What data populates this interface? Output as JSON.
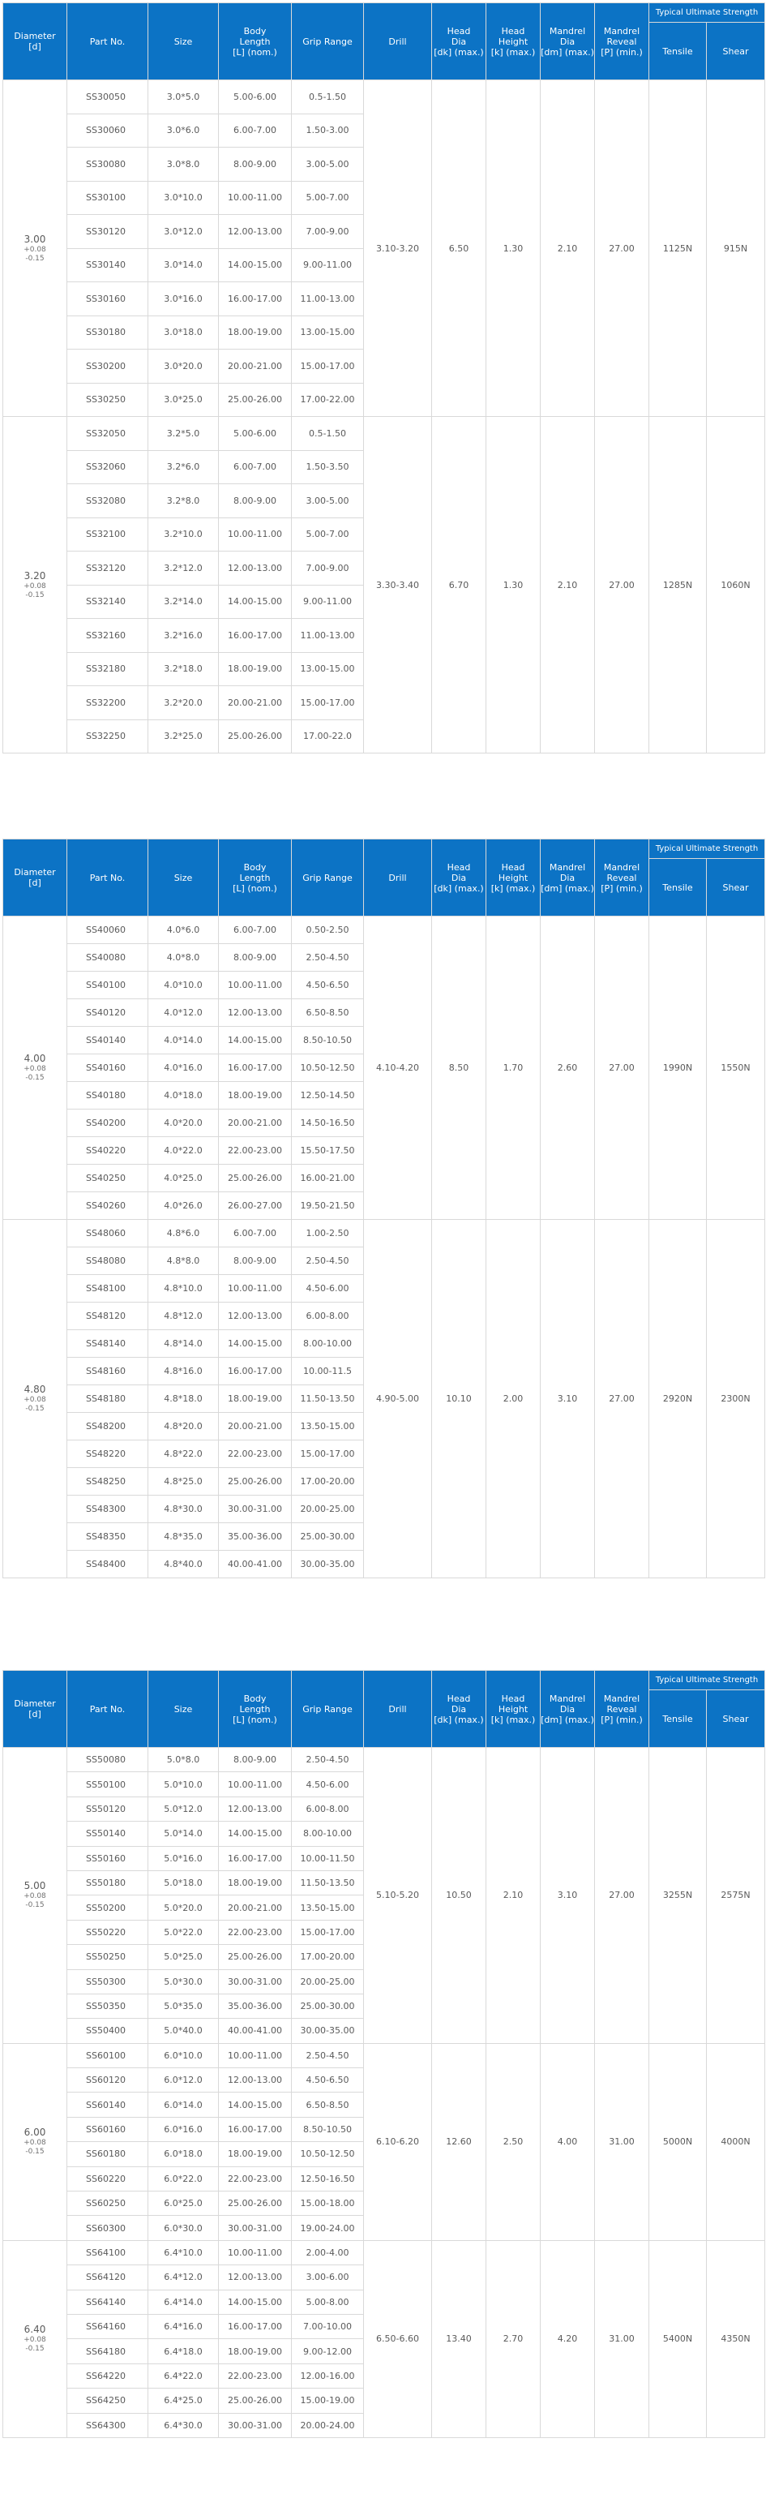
{
  "headers": {
    "diameter": [
      "Diameter",
      "[d]"
    ],
    "part_no": "Part No.",
    "size": "Size",
    "body_length": [
      "Body",
      "Length",
      "[L] (nom.)"
    ],
    "grip_range": "Grip Range",
    "drill": "Drill",
    "head_dia": [
      "Head",
      "Dia",
      "[dk] (max.)"
    ],
    "head_height": [
      "Head",
      "Height",
      "[k] (max.)"
    ],
    "mandrel_dia": [
      "Mandrel",
      "Dia",
      "[dm] (max.)"
    ],
    "mandrel_reveal": [
      "Mandrel",
      "Reveal",
      "[P] (min.)"
    ],
    "typical_strength": "Typical Ultimate Strength",
    "tensile": "Tensile",
    "shear": "Shear"
  },
  "tables": [
    {
      "groups": [
        {
          "diameter": "3.00",
          "tol_plus": "+0.08",
          "tol_minus": "-0.15",
          "drill": "3.10-3.20",
          "head_dia": "6.50",
          "head_height": "1.30",
          "mandrel_dia": "2.10",
          "mandrel_reveal": "27.00",
          "tensile": "1125N",
          "shear": "915N",
          "rows": [
            [
              "SS30050",
              "3.0*5.0",
              "5.00-6.00",
              "0.5-1.50"
            ],
            [
              "SS30060",
              "3.0*6.0",
              "6.00-7.00",
              "1.50-3.00"
            ],
            [
              "SS30080",
              "3.0*8.0",
              "8.00-9.00",
              "3.00-5.00"
            ],
            [
              "SS30100",
              "3.0*10.0",
              "10.00-11.00",
              "5.00-7.00"
            ],
            [
              "SS30120",
              "3.0*12.0",
              "12.00-13.00",
              "7.00-9.00"
            ],
            [
              "SS30140",
              "3.0*14.0",
              "14.00-15.00",
              "9.00-11.00"
            ],
            [
              "SS30160",
              "3.0*16.0",
              "16.00-17.00",
              "11.00-13.00"
            ],
            [
              "SS30180",
              "3.0*18.0",
              "18.00-19.00",
              "13.00-15.00"
            ],
            [
              "SS30200",
              "3.0*20.0",
              "20.00-21.00",
              "15.00-17.00"
            ],
            [
              "SS30250",
              "3.0*25.0",
              "25.00-26.00",
              "17.00-22.00"
            ]
          ]
        },
        {
          "diameter": "3.20",
          "tol_plus": "+0.08",
          "tol_minus": "-0.15",
          "drill": "3.30-3.40",
          "head_dia": "6.70",
          "head_height": "1.30",
          "mandrel_dia": "2.10",
          "mandrel_reveal": "27.00",
          "tensile": "1285N",
          "shear": "1060N",
          "rows": [
            [
              "SS32050",
              "3.2*5.0",
              "5.00-6.00",
              "0.5-1.50"
            ],
            [
              "SS32060",
              "3.2*6.0",
              "6.00-7.00",
              "1.50-3.50"
            ],
            [
              "SS32080",
              "3.2*8.0",
              "8.00-9.00",
              "3.00-5.00"
            ],
            [
              "SS32100",
              "3.2*10.0",
              "10.00-11.00",
              "5.00-7.00"
            ],
            [
              "SS32120",
              "3.2*12.0",
              "12.00-13.00",
              "7.00-9.00"
            ],
            [
              "SS32140",
              "3.2*14.0",
              "14.00-15.00",
              "9.00-11.00"
            ],
            [
              "SS32160",
              "3.2*16.0",
              "16.00-17.00",
              "11.00-13.00"
            ],
            [
              "SS32180",
              "3.2*18.0",
              "18.00-19.00",
              "13.00-15.00"
            ],
            [
              "SS32200",
              "3.2*20.0",
              "20.00-21.00",
              "15.00-17.00"
            ],
            [
              "SS32250",
              "3.2*25.0",
              "25.00-26.00",
              "17.00-22.0"
            ]
          ]
        }
      ]
    },
    {
      "groups": [
        {
          "diameter": "4.00",
          "tol_plus": "+0.08",
          "tol_minus": "-0.15",
          "drill": "4.10-4.20",
          "head_dia": "8.50",
          "head_height": "1.70",
          "mandrel_dia": "2.60",
          "mandrel_reveal": "27.00",
          "tensile": "1990N",
          "shear": "1550N",
          "rows": [
            [
              "SS40060",
              "4.0*6.0",
              "6.00-7.00",
              "0.50-2.50"
            ],
            [
              "SS40080",
              "4.0*8.0",
              "8.00-9.00",
              "2.50-4.50"
            ],
            [
              "SS40100",
              "4.0*10.0",
              "10.00-11.00",
              "4.50-6.50"
            ],
            [
              "SS40120",
              "4.0*12.0",
              "12.00-13.00",
              "6.50-8.50"
            ],
            [
              "SS40140",
              "4.0*14.0",
              "14.00-15.00",
              "8.50-10.50"
            ],
            [
              "SS40160",
              "4.0*16.0",
              "16.00-17.00",
              "10.50-12.50"
            ],
            [
              "SS40180",
              "4.0*18.0",
              "18.00-19.00",
              "12.50-14.50"
            ],
            [
              "SS40200",
              "4.0*20.0",
              "20.00-21.00",
              "14.50-16.50"
            ],
            [
              "SS40220",
              "4.0*22.0",
              "22.00-23.00",
              "15.50-17.50"
            ],
            [
              "SS40250",
              "4.0*25.0",
              "25.00-26.00",
              "16.00-21.00"
            ],
            [
              "SS40260",
              "4.0*26.0",
              "26.00-27.00",
              "19.50-21.50"
            ]
          ]
        },
        {
          "diameter": "4.80",
          "tol_plus": "+0.08",
          "tol_minus": "-0.15",
          "drill": "4.90-5.00",
          "head_dia": "10.10",
          "head_height": "2.00",
          "mandrel_dia": "3.10",
          "mandrel_reveal": "27.00",
          "tensile": "2920N",
          "shear": "2300N",
          "rows": [
            [
              "SS48060",
              "4.8*6.0",
              "6.00-7.00",
              "1.00-2.50"
            ],
            [
              "SS48080",
              "4.8*8.0",
              "8.00-9.00",
              "2.50-4.50"
            ],
            [
              "SS48100",
              "4.8*10.0",
              "10.00-11.00",
              "4.50-6.00"
            ],
            [
              "SS48120",
              "4.8*12.0",
              "12.00-13.00",
              "6.00-8.00"
            ],
            [
              "SS48140",
              "4.8*14.0",
              "14.00-15.00",
              "8.00-10.00"
            ],
            [
              "SS48160",
              "4.8*16.0",
              "16.00-17.00",
              "10.00-11.5"
            ],
            [
              "SS48180",
              "4.8*18.0",
              "18.00-19.00",
              "11.50-13.50"
            ],
            [
              "SS48200",
              "4.8*20.0",
              "20.00-21.00",
              "13.50-15.00"
            ],
            [
              "SS48220",
              "4.8*22.0",
              "22.00-23.00",
              "15.00-17.00"
            ],
            [
              "SS48250",
              "4.8*25.0",
              "25.00-26.00",
              "17.00-20.00"
            ],
            [
              "SS48300",
              "4.8*30.0",
              "30.00-31.00",
              "20.00-25.00"
            ],
            [
              "SS48350",
              "4.8*35.0",
              "35.00-36.00",
              "25.00-30.00"
            ],
            [
              "SS48400",
              "4.8*40.0",
              "40.00-41.00",
              "30.00-35.00"
            ]
          ]
        }
      ]
    },
    {
      "groups": [
        {
          "diameter": "5.00",
          "tol_plus": "+0.08",
          "tol_minus": "-0.15",
          "drill": "5.10-5.20",
          "head_dia": "10.50",
          "head_height": "2.10",
          "mandrel_dia": "3.10",
          "mandrel_reveal": "27.00",
          "tensile": "3255N",
          "shear": "2575N",
          "rows": [
            [
              "SS50080",
              "5.0*8.0",
              "8.00-9.00",
              "2.50-4.50"
            ],
            [
              "SS50100",
              "5.0*10.0",
              "10.00-11.00",
              "4.50-6.00"
            ],
            [
              "SS50120",
              "5.0*12.0",
              "12.00-13.00",
              "6.00-8.00"
            ],
            [
              "SS50140",
              "5.0*14.0",
              "14.00-15.00",
              "8.00-10.00"
            ],
            [
              "SS50160",
              "5.0*16.0",
              "16.00-17.00",
              "10.00-11.50"
            ],
            [
              "SS50180",
              "5.0*18.0",
              "18.00-19.00",
              "11.50-13.50"
            ],
            [
              "SS50200",
              "5.0*20.0",
              "20.00-21.00",
              "13.50-15.00"
            ],
            [
              "SS50220",
              "5.0*22.0",
              "22.00-23.00",
              "15.00-17.00"
            ],
            [
              "SS50250",
              "5.0*25.0",
              "25.00-26.00",
              "17.00-20.00"
            ],
            [
              "SS50300",
              "5.0*30.0",
              "30.00-31.00",
              "20.00-25.00"
            ],
            [
              "SS50350",
              "5.0*35.0",
              "35.00-36.00",
              "25.00-30.00"
            ],
            [
              "SS50400",
              "5.0*40.0",
              "40.00-41.00",
              "30.00-35.00"
            ]
          ]
        },
        {
          "diameter": "6.00",
          "tol_plus": "+0.08",
          "tol_minus": "-0.15",
          "drill": "6.10-6.20",
          "head_dia": "12.60",
          "head_height": "2.50",
          "mandrel_dia": "4.00",
          "mandrel_reveal": "31.00",
          "tensile": "5000N",
          "shear": "4000N",
          "rows": [
            [
              "SS60100",
              "6.0*10.0",
              "10.00-11.00",
              "2.50-4.50"
            ],
            [
              "SS60120",
              "6.0*12.0",
              "12.00-13.00",
              "4.50-6.50"
            ],
            [
              "SS60140",
              "6.0*14.0",
              "14.00-15.00",
              "6.50-8.50"
            ],
            [
              "SS60160",
              "6.0*16.0",
              "16.00-17.00",
              "8.50-10.50"
            ],
            [
              "SS60180",
              "6.0*18.0",
              "18.00-19.00",
              "10.50-12.50"
            ],
            [
              "SS60220",
              "6.0*22.0",
              "22.00-23.00",
              "12.50-16.50"
            ],
            [
              "SS60250",
              "6.0*25.0",
              "25.00-26.00",
              "15.00-18.00"
            ],
            [
              "SS60300",
              "6.0*30.0",
              "30.00-31.00",
              "19.00-24.00"
            ]
          ]
        },
        {
          "diameter": "6.40",
          "tol_plus": "+0.08",
          "tol_minus": "-0.15",
          "drill": "6.50-6.60",
          "head_dia": "13.40",
          "head_height": "2.70",
          "mandrel_dia": "4.20",
          "mandrel_reveal": "31.00",
          "tensile": "5400N",
          "shear": "4350N",
          "rows": [
            [
              "SS64100",
              "6.4*10.0",
              "10.00-11.00",
              "2.00-4.00"
            ],
            [
              "SS64120",
              "6.4*12.0",
              "12.00-13.00",
              "3.00-6.00"
            ],
            [
              "SS64140",
              "6.4*14.0",
              "14.00-15.00",
              "5.00-8.00"
            ],
            [
              "SS64160",
              "6.4*16.0",
              "16.00-17.00",
              "7.00-10.00"
            ],
            [
              "SS64180",
              "6.4*18.0",
              "18.00-19.00",
              "9.00-12.00"
            ],
            [
              "SS64220",
              "6.4*22.0",
              "22.00-23.00",
              "12.00-16.00"
            ],
            [
              "SS64250",
              "6.4*25.0",
              "25.00-26.00",
              "15.00-19.00"
            ],
            [
              "SS64300",
              "6.4*30.0",
              "30.00-31.00",
              "20.00-24.00"
            ]
          ]
        }
      ]
    }
  ]
}
